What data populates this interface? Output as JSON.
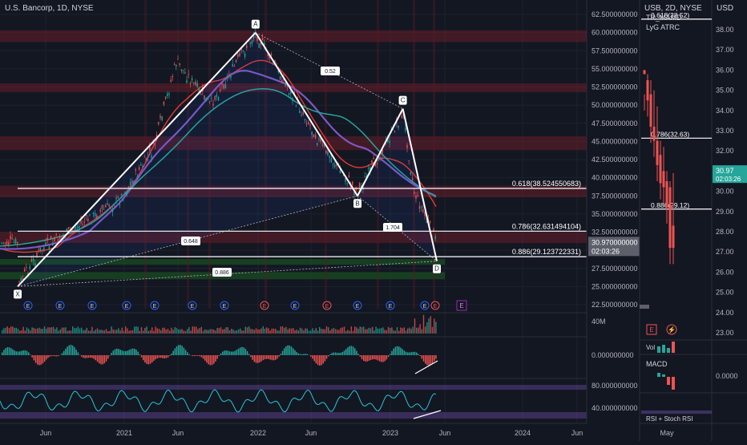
{
  "main_chart": {
    "title": "U.S. Bancorp, 1D, NYSE",
    "y_ticks": [
      "62.500000000",
      "60.000000000",
      "57.500000000",
      "55.000000000",
      "52.500000000",
      "50.000000000",
      "47.500000000",
      "45.000000000",
      "42.500000000",
      "40.000000000",
      "37.500000000",
      "35.000000000",
      "32.500000000",
      "30.000000000",
      "27.500000000",
      "25.000000000",
      "22.500000000"
    ],
    "x_ticks": [
      "Jun",
      "2021",
      "Jun",
      "2022",
      "Jun",
      "2023",
      "Jun",
      "2024",
      "Jun"
    ],
    "price_label": "30.970000000",
    "countdown": "02:03:26",
    "fib_lines": [
      {
        "label": "0.618(38.524550683)",
        "value": 38.52
      },
      {
        "label": "0.786(32.631494104)",
        "value": 32.63
      },
      {
        "label": "0.886(29.123722331)",
        "value": 29.12
      }
    ],
    "pattern_points": [
      {
        "name": "X",
        "date": "2020-04",
        "price": 25.0
      },
      {
        "name": "A",
        "date": "2022-01",
        "price": 60.0
      },
      {
        "name": "B",
        "date": "2022-10",
        "price": 37.5
      },
      {
        "name": "C",
        "date": "2023-02",
        "price": 49.5
      },
      {
        "name": "D",
        "date": "2023-05",
        "price": 28.5
      }
    ],
    "ratio_labels": [
      "0.52",
      "0.648",
      "1.704",
      "0.886"
    ],
    "vol_axis": "40M",
    "macd_axis": "0.000000000",
    "rsi_axis": [
      "80.000000000",
      "40.000000000"
    ],
    "event_markers": [
      "E",
      "E",
      "E",
      "E",
      "E",
      "E",
      "E",
      "E",
      "E",
      "E",
      "E",
      "E",
      "E",
      "E"
    ]
  },
  "side_chart": {
    "title": "USB, 2D, NYSE",
    "currency": "USD",
    "indicator_1": "TR_MAMD",
    "indicator_2": "LyG ATRC",
    "y_ticks": [
      "38.00",
      "37.00",
      "36.00",
      "35.00",
      "34.00",
      "33.00",
      "32.00",
      "31.00",
      "30.00",
      "29.00",
      "28.00",
      "27.00",
      "26.00",
      "25.00",
      "24.00",
      "23.00"
    ],
    "price_label": "30.97",
    "countdown": "02:03:26",
    "fib_lines": [
      "0.618(38.52)",
      "0.786(32.63)",
      "0.886(29.12)"
    ],
    "vol_label": "Vol",
    "macd_label": "MACD",
    "macd_axis": "0.0000",
    "rsi_label": "RSI + Stoch RSI",
    "x_tick": "May",
    "marker_e": "E",
    "marker_flash": "⚡"
  },
  "chart_data": {
    "type": "line",
    "title": "U.S. Bancorp, 1D, NYSE",
    "xlabel": "",
    "ylabel": "",
    "ylim": [
      22.5,
      62.5
    ],
    "x": [
      "2020-04",
      "2020-06",
      "2020-09",
      "2021-01",
      "2021-04",
      "2021-06",
      "2021-09",
      "2022-01",
      "2022-04",
      "2022-07",
      "2022-10",
      "2023-01",
      "2023-02",
      "2023-03",
      "2023-05"
    ],
    "series": [
      {
        "name": "",
        "values": [
          25,
          30,
          33,
          37,
          44,
          56,
          50,
          60,
          52,
          44,
          38,
          46,
          49,
          38,
          31
        ]
      }
    ]
  }
}
